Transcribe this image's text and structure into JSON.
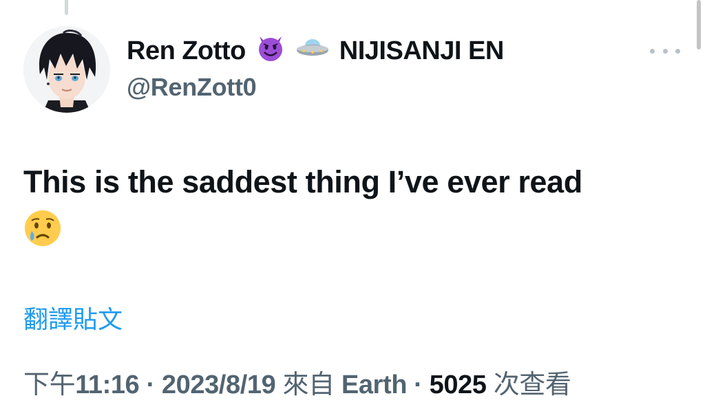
{
  "author": {
    "display_name": "Ren Zotto",
    "affiliation": "NIJISANJI EN",
    "handle": "@RenZott0",
    "badges": [
      "smiling-devil-emoji",
      "flying-saucer-emoji"
    ]
  },
  "tweet": {
    "text": "This is the saddest thing I’ve ever read",
    "trailing_emoji": "crying-face-emoji",
    "translate_label": "翻譯貼文"
  },
  "meta": {
    "time_prefix": "下午",
    "time": "11:16",
    "separator": " · ",
    "date": "2023/8/19",
    "source_prefix": "來自",
    "source": "Earth",
    "views": "5025",
    "views_label": "次查看"
  },
  "icons": {
    "more": "more-horizontal-icon"
  },
  "colors": {
    "text_primary": "#0f1419",
    "text_secondary": "#536471",
    "link": "#1d9bf0"
  }
}
